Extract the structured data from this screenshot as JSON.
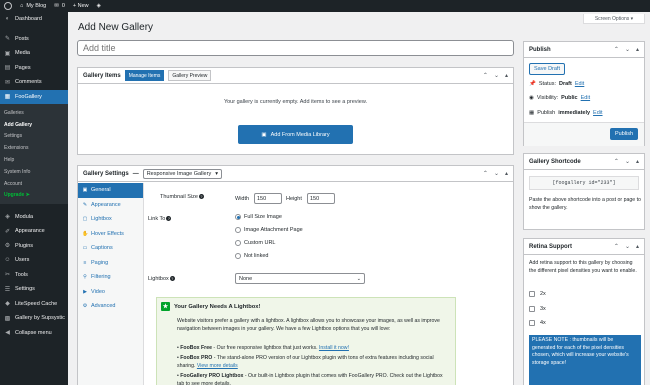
{
  "adminbar": {
    "site_name": "My Blog",
    "comments_count": "0",
    "new_label": "+ New"
  },
  "sidebar": {
    "items_top": [
      {
        "label": "Dashboard",
        "icon": "dashboard-icon",
        "glyph": "◐"
      }
    ],
    "items_mid": [
      {
        "label": "Posts",
        "icon": "pin-icon",
        "glyph": "✎"
      },
      {
        "label": "Media",
        "icon": "media-icon",
        "glyph": "▣"
      },
      {
        "label": "Pages",
        "icon": "page-icon",
        "glyph": "▤"
      },
      {
        "label": "Comments",
        "icon": "comment-icon",
        "glyph": "✉"
      }
    ],
    "active_item": {
      "label": "FooGallery",
      "icon": "gallery-icon",
      "glyph": "▦"
    },
    "submenu": [
      {
        "label": "Galleries"
      },
      {
        "label": "Add Gallery"
      },
      {
        "label": "Settings"
      },
      {
        "label": "Extensions"
      },
      {
        "label": "Help"
      },
      {
        "label": "System Info"
      },
      {
        "label": "Account"
      },
      {
        "label": "Upgrade ➤"
      }
    ],
    "items_bottom": [
      {
        "label": "Modula",
        "icon": "modula-icon",
        "glyph": "◈"
      },
      {
        "label": "Appearance",
        "icon": "brush-icon",
        "glyph": "✐"
      },
      {
        "label": "Plugins",
        "icon": "plugin-icon",
        "glyph": "⚙"
      },
      {
        "label": "Users",
        "icon": "user-icon",
        "glyph": "☺"
      },
      {
        "label": "Tools",
        "icon": "wrench-icon",
        "glyph": "✂"
      },
      {
        "label": "Settings",
        "icon": "settings-icon",
        "glyph": "☰"
      },
      {
        "label": "LiteSpeed Cache",
        "icon": "litespeed-icon",
        "glyph": "◆"
      },
      {
        "label": "Gallery by Supsystic",
        "icon": "supsystic-icon",
        "glyph": "▩"
      },
      {
        "label": "Collapse menu",
        "icon": "collapse-icon",
        "glyph": "◀"
      }
    ]
  },
  "screen_options": "Screen Options ▾",
  "page_title": "Add New Gallery",
  "title_placeholder": "Add title",
  "gallery_items": {
    "title": "Gallery Items",
    "tabs": [
      "Manage Items",
      "Gallery Preview"
    ],
    "empty_message": "Your gallery is currently empty. Add items to see a preview.",
    "add_button": "Add From Media Library"
  },
  "gallery_settings": {
    "title": "Gallery Settings",
    "template": "Responsive Image Gallery",
    "nav": [
      {
        "label": "General",
        "icon": "general-icon",
        "glyph": "▣"
      },
      {
        "label": "Appearance",
        "icon": "appearance-icon",
        "glyph": "✎"
      },
      {
        "label": "Lightbox",
        "icon": "lightbox-icon",
        "glyph": "▢"
      },
      {
        "label": "Hover Effects",
        "icon": "hover-icon",
        "glyph": "✋"
      },
      {
        "label": "Captions",
        "icon": "captions-icon",
        "glyph": "▭"
      },
      {
        "label": "Paging",
        "icon": "paging-icon",
        "glyph": "≡"
      },
      {
        "label": "Filtering",
        "icon": "filter-icon",
        "glyph": "⚲"
      },
      {
        "label": "Video",
        "icon": "video-icon",
        "glyph": "▶"
      },
      {
        "label": "Advanced",
        "icon": "advanced-icon",
        "glyph": "⚙"
      }
    ],
    "thumbnail_size_label": "Thumbnail Size",
    "width_label": "Width",
    "width_value": "150",
    "height_label": "Height",
    "height_value": "150",
    "link_to_label": "Link To",
    "link_options": [
      "Full Size Image",
      "Image Attachment Page",
      "Custom URL",
      "Not linked"
    ],
    "lightbox_label": "Lightbox",
    "lightbox_value": "None",
    "notice": {
      "title": "Your Gallery Needs A Lightbox!",
      "text": "Website visitors prefer a gallery with a lightbox. A lightbox allows you to showcase your images, as well as improve navigation between images in your gallery. We have a few Lightbox options that you will love:",
      "items": [
        {
          "bold": "FooBox Free",
          "text": " - Our free responsive lightbox that just works. ",
          "link": "Install it now!"
        },
        {
          "bold": "FooBox PRO",
          "text": " - The stand-alone PRO version of our Lightbox plugin with tons of extra features including social sharing. ",
          "link": "View more details"
        },
        {
          "bold": "FooGallery PRO Lightbox",
          "text": " - Our built-in Lightbox plugin that comes with FooGallery PRO. Check out the Lightbox tab to see more details.",
          "link": ""
        }
      ]
    }
  },
  "publish": {
    "title": "Publish",
    "save_draft": "Save Draft",
    "status_label": "Status:",
    "status_value": "Draft",
    "visibility_label": "Visibility:",
    "visibility_value": "Public",
    "publish_label": "Publish",
    "publish_value": "immediately",
    "edit_link": "Edit",
    "publish_button": "Publish"
  },
  "shortcode": {
    "title": "Gallery Shortcode",
    "code": "[foogallery id=\"233\"]",
    "text": "Paste the above shortcode into a post or page to show the gallery."
  },
  "retina": {
    "title": "Retina Support",
    "text": "Add retina support to this gallery by choosing the different pixel densities you want to enable.",
    "options": [
      "2x",
      "3x",
      "4x"
    ],
    "note": "PLEASE NOTE : thumbnails will be generated for each of the pixel densities chosen, which will increase your website's storage space!"
  },
  "colors": {
    "accent": "#2271b1",
    "admin_dark": "#1d2327",
    "notice_green": "#00a32a"
  }
}
